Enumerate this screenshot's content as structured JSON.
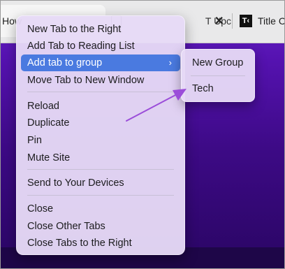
{
  "tabs": [
    {
      "title": "How"
    },
    {
      "title": "T Upc",
      "close": "✕"
    },
    {
      "favicon": "T‹",
      "title": "Title C"
    }
  ],
  "context_menu": {
    "items": [
      "New Tab to the Right",
      "Add Tab to Reading List",
      "Add tab to group",
      "Move Tab to New Window",
      "Reload",
      "Duplicate",
      "Pin",
      "Mute Site",
      "Send to Your Devices",
      "Close",
      "Close Other Tabs",
      "Close Tabs to the Right"
    ],
    "active_item": "Add tab to group",
    "submenu_arrow": "›"
  },
  "submenu": {
    "items": [
      "New Group",
      "Tech"
    ]
  },
  "annotation": {
    "icon": "arrow-pointer-icon",
    "color": "#9b4dd9"
  }
}
